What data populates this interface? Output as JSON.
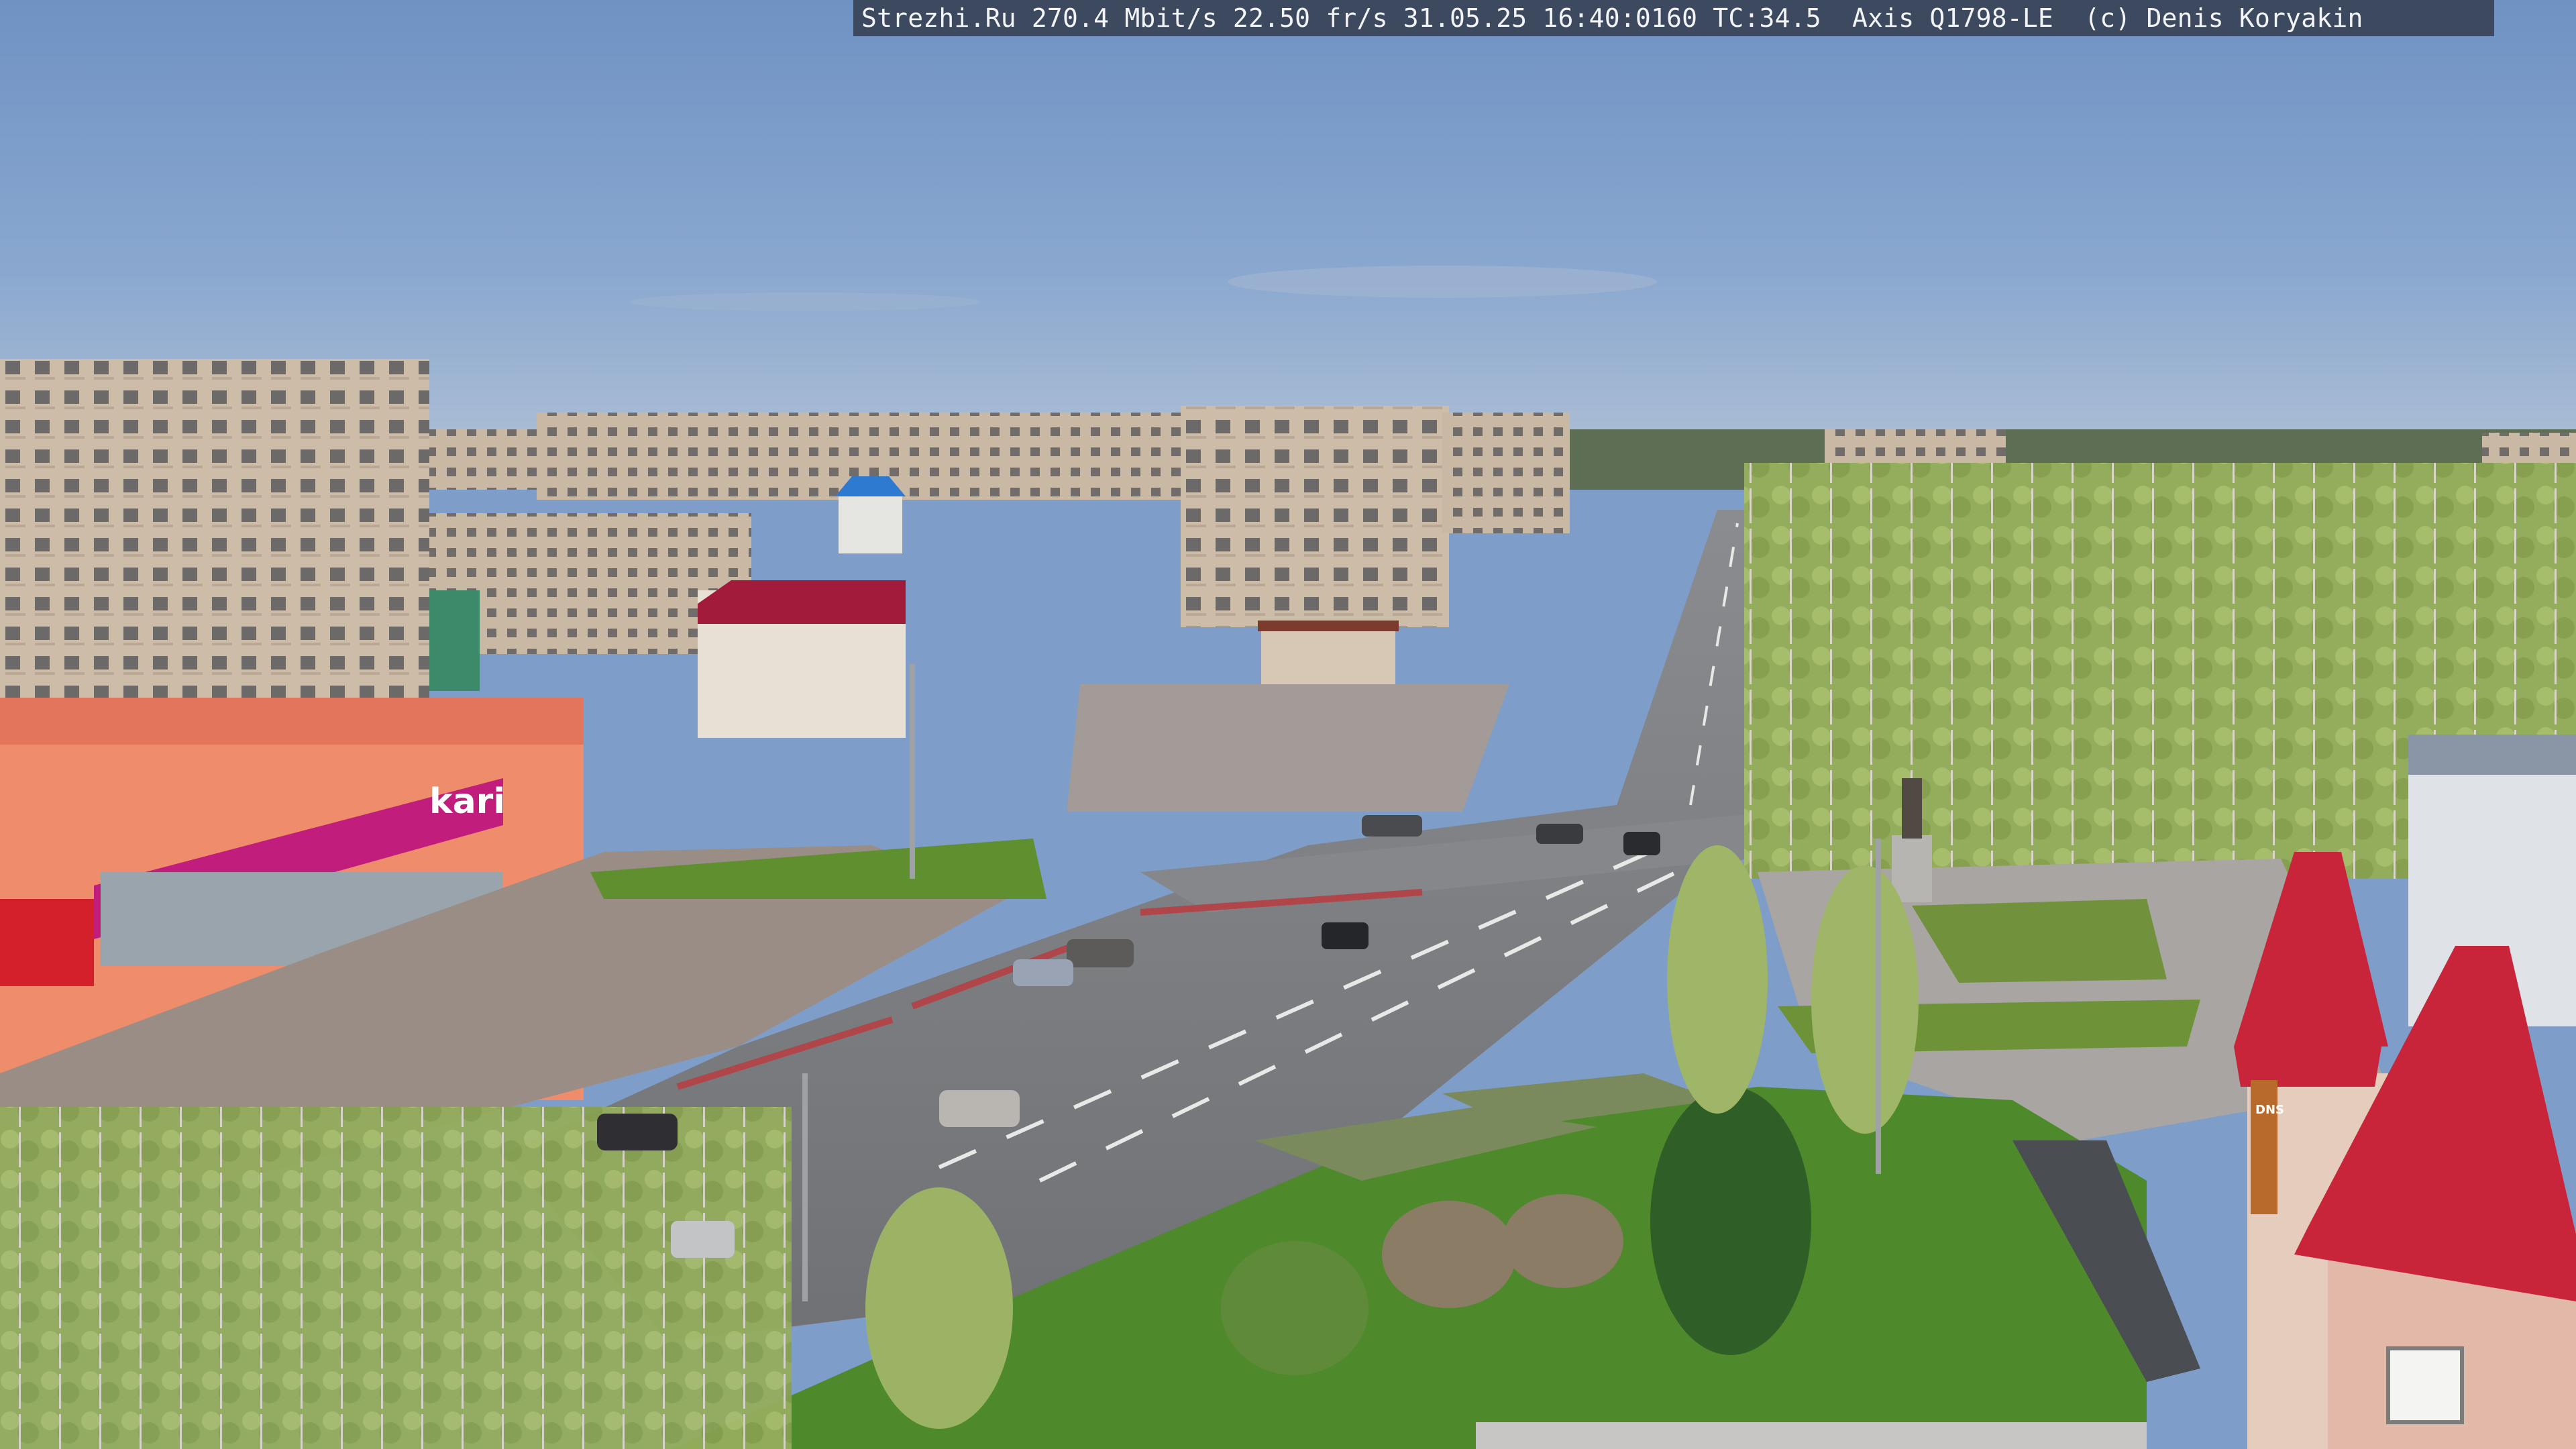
{
  "overlay": {
    "text": "Strezhi.Ru 270.4 Mbit/s 22.50 fr/s 31.05.25 16:40:0160 TC:34.5  Axis Q1798-LE  (c) Denis Koryakin"
  },
  "scene": {
    "kind": "webcam-photo",
    "description_colors": {
      "sky": "#7fa0cc",
      "foliage": "#8fa857",
      "asphalt": "#7d7f83",
      "plaza": "#9a8d86",
      "lawn": "#5f8f2e",
      "panel_building": "#c8b7a4",
      "storefront": "#ee8c6c",
      "kari_banner": "#c01d7c",
      "red_roof": "#c8243a"
    },
    "signage": {
      "store_banner": "kari",
      "dns_sign": "DNS"
    }
  }
}
